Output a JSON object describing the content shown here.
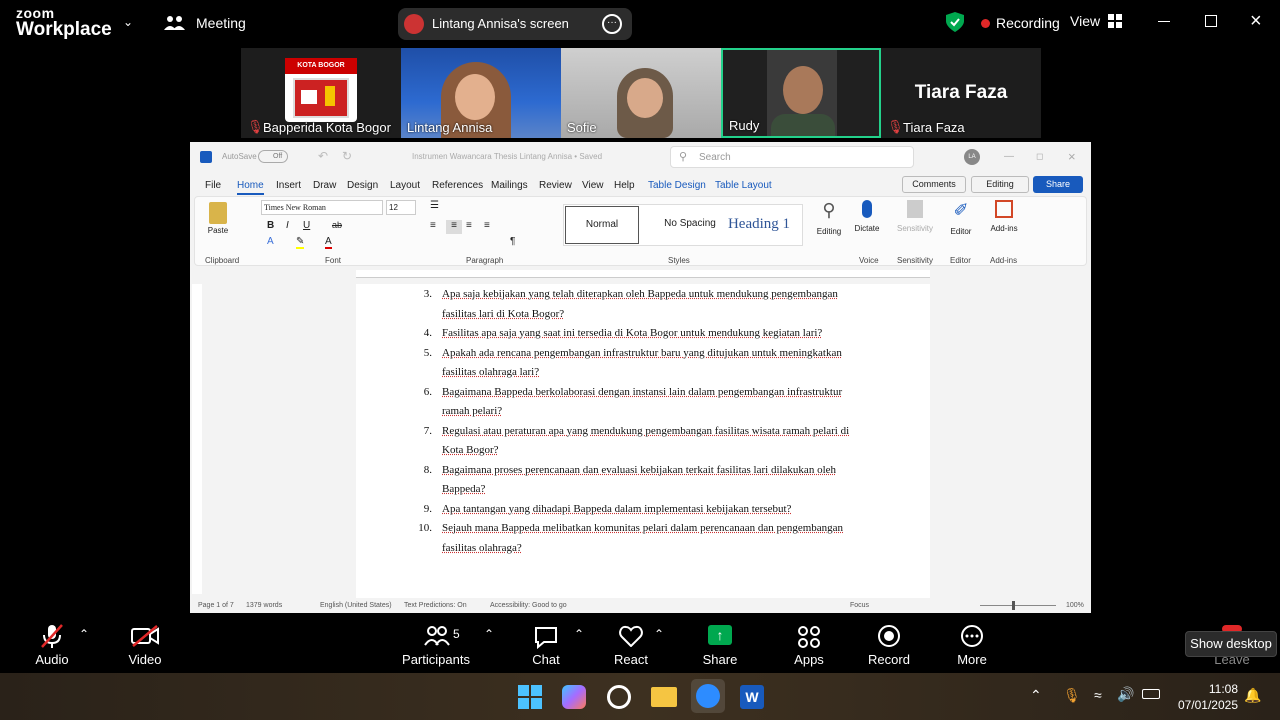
{
  "topbar": {
    "logo_line1": "zoom",
    "logo_line2": "Workplace",
    "meeting_label": "Meeting",
    "share_label": "Lintang Annisa's screen",
    "recording_label": "Recording",
    "view_label": "View"
  },
  "participants_strip": [
    {
      "name": "Bapperida Kota Bogor",
      "muted": true,
      "logo_text": "KOTA BOGOR"
    },
    {
      "name": "Lintang Annisa",
      "muted": false
    },
    {
      "name": "Sofie",
      "muted": false
    },
    {
      "name": "Rudy",
      "muted": false,
      "active_speaker": true
    },
    {
      "name": "Tiara Faza",
      "muted": true,
      "display_name_large": "Tiara Faza"
    }
  ],
  "word": {
    "autosave": "AutoSave",
    "autosave_state": "Off",
    "doc_title": "Instrumen Wawancara Thesis Lintang Annisa • Saved",
    "search_placeholder": "Search",
    "avatar_initials": "LA",
    "menu": [
      "File",
      "Home",
      "Insert",
      "Draw",
      "Design",
      "Layout",
      "References",
      "Mailings",
      "Review",
      "View",
      "Help",
      "Table Design",
      "Table Layout"
    ],
    "comments_label": "Comments",
    "editing_label": "Editing",
    "share_label": "Share",
    "font_name": "Times New Roman",
    "font_size": "12",
    "paste_label": "Paste",
    "styles": [
      "Normal",
      "No Spacing",
      "Heading 1"
    ],
    "ribbon_buttons": {
      "editing": "Editing",
      "dictate": "Dictate",
      "sensitivity": "Sensitivity",
      "editor": "Editor",
      "addins": "Add-ins"
    },
    "group_labels": {
      "clipboard": "Clipboard",
      "font": "Font",
      "paragraph": "Paragraph",
      "styles": "Styles",
      "voice": "Voice",
      "sensitivity": "Sensitivity",
      "editor": "Editor",
      "addins": "Add-ins"
    },
    "questions": [
      {
        "num": "3.",
        "lines": [
          "Apa saja kebijakan yang telah diterapkan oleh Bappeda untuk mendukung pengembangan",
          "fasilitas lari di Kota Bogor?"
        ]
      },
      {
        "num": "4.",
        "lines": [
          "Fasilitas apa saja yang saat ini tersedia di Kota Bogor untuk mendukung kegiatan lari?"
        ]
      },
      {
        "num": "5.",
        "lines": [
          "Apakah ada rencana pengembangan infrastruktur baru yang ditujukan untuk meningkatkan",
          "fasilitas olahraga lari?"
        ]
      },
      {
        "num": "6.",
        "lines": [
          "Bagaimana Bappeda berkolaborasi dengan instansi lain dalam pengembangan infrastruktur",
          "ramah pelari?"
        ]
      },
      {
        "num": "7.",
        "lines": [
          "Regulasi atau peraturan apa yang mendukung pengembangan fasilitas wisata ramah pelari di",
          "Kota Bogor?"
        ]
      },
      {
        "num": "8.",
        "lines": [
          "Bagaimana proses perencanaan dan evaluasi kebijakan terkait fasilitas lari dilakukan oleh",
          "Bappeda?"
        ]
      },
      {
        "num": "9.",
        "lines": [
          "Apa tantangan yang dihadapi Bappeda dalam implementasi kebijakan tersebut?"
        ]
      },
      {
        "num": "10.",
        "lines": [
          "Sejauh mana Bappeda melibatkan komunitas pelari dalam perencanaan dan pengembangan",
          "fasilitas olahraga?"
        ]
      }
    ],
    "status": {
      "page": "Page 1 of 7",
      "words": "1379 words",
      "language": "English (United States)",
      "predictions": "Text Predictions: On",
      "accessibility": "Accessibility: Good to go",
      "focus": "Focus",
      "zoom": "100%"
    }
  },
  "toolbar": {
    "audio": "Audio",
    "video": "Video",
    "participants": "Participants",
    "participants_count": "5",
    "chat": "Chat",
    "react": "React",
    "share": "Share",
    "apps": "Apps",
    "record": "Record",
    "more": "More",
    "leave": "Leave",
    "tooltip": "Show desktop"
  },
  "taskbar": {
    "time": "11:08",
    "date": "07/01/2025"
  },
  "colors": {
    "zoom_green": "#00a84f",
    "record_red": "#e02828",
    "word_blue": "#185abd",
    "active_speaker": "#23d18b",
    "muted_red": "#e04040"
  }
}
